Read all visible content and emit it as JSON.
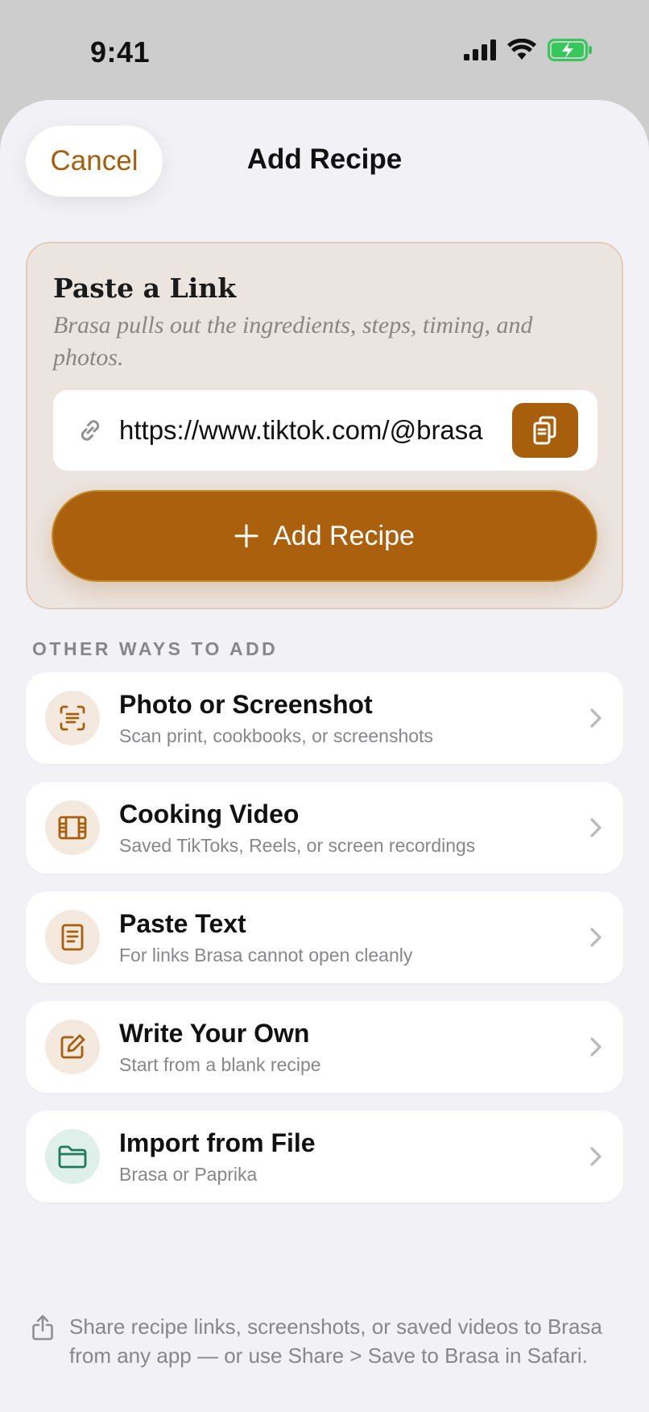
{
  "status_bar": {
    "time": "9:41"
  },
  "colors": {
    "accent": "#a85f0c",
    "sheet_bg": "#f1f1f6",
    "paste_card_bg": "#ece4df",
    "icon_bg_warm": "#f4e9df",
    "icon_bg_green": "#dff0ea",
    "icon_green": "#1f7a5a",
    "battery_green": "#34c759"
  },
  "header": {
    "cancel_label": "Cancel",
    "title": "Add Recipe"
  },
  "paste_link": {
    "title": "Paste a Link",
    "subtitle": "Brasa pulls out the ingredients, steps, timing, and photos.",
    "url_value": "https://www.tiktok.com/@brasa",
    "link_icon": "link-icon",
    "paste_icon": "clipboard-icon",
    "add_button_label": "Add Recipe"
  },
  "other_ways": {
    "header": "OTHER WAYS TO ADD",
    "items": [
      {
        "title": "Photo or Screenshot",
        "subtitle": "Scan print, cookbooks, or screenshots",
        "icon": "scan-text-icon"
      },
      {
        "title": "Cooking Video",
        "subtitle": "Saved TikToks, Reels, or screen recordings",
        "icon": "film-icon"
      },
      {
        "title": "Paste Text",
        "subtitle": "For links Brasa cannot open cleanly",
        "icon": "document-text-icon"
      },
      {
        "title": "Write Your Own",
        "subtitle": "Start from a blank recipe",
        "icon": "compose-icon"
      },
      {
        "title": "Import from File",
        "subtitle": "Brasa or Paprika",
        "icon": "folder-icon"
      }
    ]
  },
  "footer": {
    "note": "Share recipe links, screenshots, or saved videos to Brasa from any app — or use Share > Save to Brasa in Safari."
  }
}
